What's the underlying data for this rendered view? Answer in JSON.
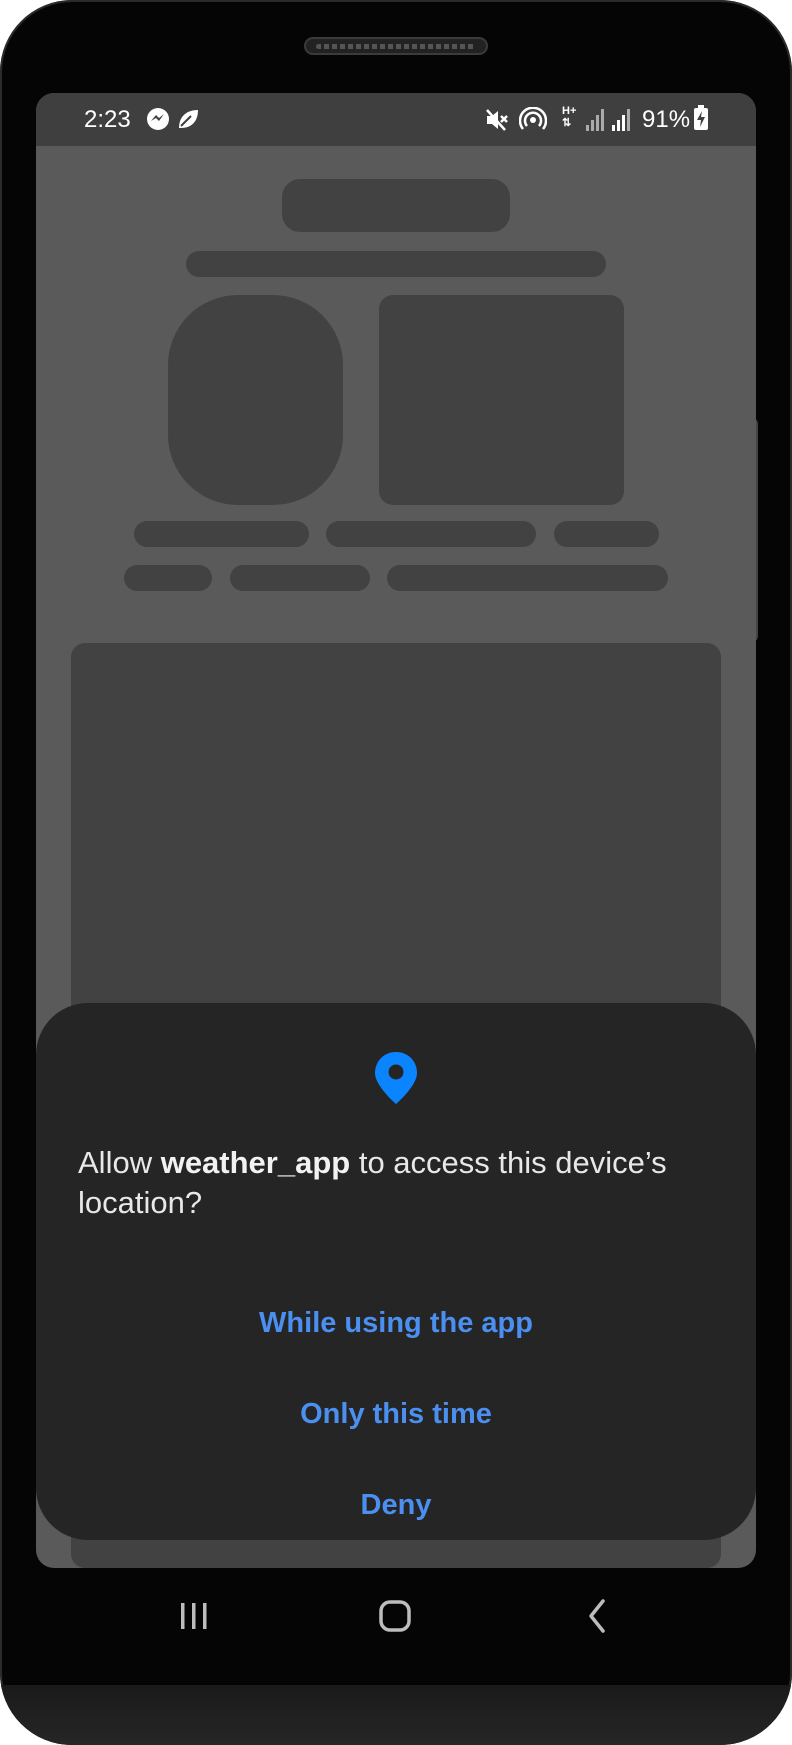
{
  "status_bar": {
    "time": "2:23",
    "battery": "91%",
    "icons": [
      "messenger-icon",
      "leaf-icon",
      "mute-icon",
      "hotspot-icon",
      "hplus-data-icon",
      "signal-icon",
      "signal-icon",
      "battery-charging-icon"
    ]
  },
  "dialog": {
    "icon": "location-pin-icon",
    "prompt_prefix": "Allow ",
    "app_name": "weather_app",
    "prompt_suffix": " to access this device’s location?",
    "options": [
      "While using the app",
      "Only this time",
      "Deny"
    ]
  },
  "nav_bar": {
    "buttons": [
      "recent-apps-icon",
      "home-icon",
      "back-icon"
    ]
  },
  "colors": {
    "accent": "#4b8ff0",
    "pin": "#0a84ff",
    "sheet": "#252525",
    "dim_background": "#5a5a5a",
    "skeleton": "#424242"
  }
}
